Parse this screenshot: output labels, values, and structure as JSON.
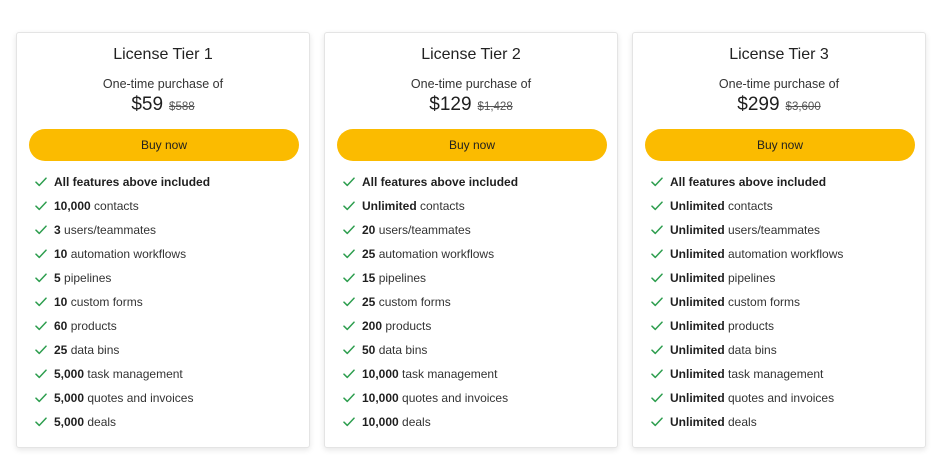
{
  "colors": {
    "accent": "#fbbb00",
    "check": "#2e9e4f"
  },
  "tiers": [
    {
      "title": "License Tier 1",
      "subtitle": "One-time purchase of",
      "price": "$59",
      "old_price": "$588",
      "button_label": "Buy now",
      "features": [
        {
          "bold": "All features above included",
          "text": ""
        },
        {
          "bold": "10,000",
          "text": " contacts"
        },
        {
          "bold": "3",
          "text": " users/teammates"
        },
        {
          "bold": "10",
          "text": " automation workflows"
        },
        {
          "bold": "5",
          "text": " pipelines"
        },
        {
          "bold": "10",
          "text": " custom forms"
        },
        {
          "bold": "60",
          "text": " products"
        },
        {
          "bold": "25",
          "text": " data bins"
        },
        {
          "bold": "5,000",
          "text": " task management"
        },
        {
          "bold": "5,000",
          "text": " quotes and invoices"
        },
        {
          "bold": "5,000",
          "text": " deals"
        }
      ]
    },
    {
      "title": "License Tier 2",
      "subtitle": "One-time purchase of",
      "price": "$129",
      "old_price": "$1,428",
      "button_label": "Buy now",
      "features": [
        {
          "bold": "All features above included",
          "text": ""
        },
        {
          "bold": "Unlimited",
          "text": " contacts"
        },
        {
          "bold": "20",
          "text": " users/teammates"
        },
        {
          "bold": "25",
          "text": " automation workflows"
        },
        {
          "bold": "15",
          "text": " pipelines"
        },
        {
          "bold": "25",
          "text": " custom forms"
        },
        {
          "bold": "200",
          "text": " products"
        },
        {
          "bold": "50",
          "text": " data bins"
        },
        {
          "bold": "10,000",
          "text": " task management"
        },
        {
          "bold": "10,000",
          "text": " quotes and invoices"
        },
        {
          "bold": "10,000",
          "text": " deals"
        }
      ]
    },
    {
      "title": "License Tier 3",
      "subtitle": "One-time purchase of",
      "price": "$299",
      "old_price": "$3,600",
      "button_label": "Buy now",
      "features": [
        {
          "bold": "All features above included",
          "text": ""
        },
        {
          "bold": "Unlimited",
          "text": " contacts"
        },
        {
          "bold": "Unlimited",
          "text": " users/teammates"
        },
        {
          "bold": "Unlimited",
          "text": " automation workflows"
        },
        {
          "bold": "Unlimited",
          "text": " pipelines"
        },
        {
          "bold": "Unlimited",
          "text": " custom forms"
        },
        {
          "bold": "Unlimited",
          "text": " products"
        },
        {
          "bold": "Unlimited",
          "text": " data bins"
        },
        {
          "bold": "Unlimited",
          "text": " task management"
        },
        {
          "bold": "Unlimited",
          "text": " quotes and invoices"
        },
        {
          "bold": "Unlimited",
          "text": " deals"
        }
      ]
    }
  ]
}
